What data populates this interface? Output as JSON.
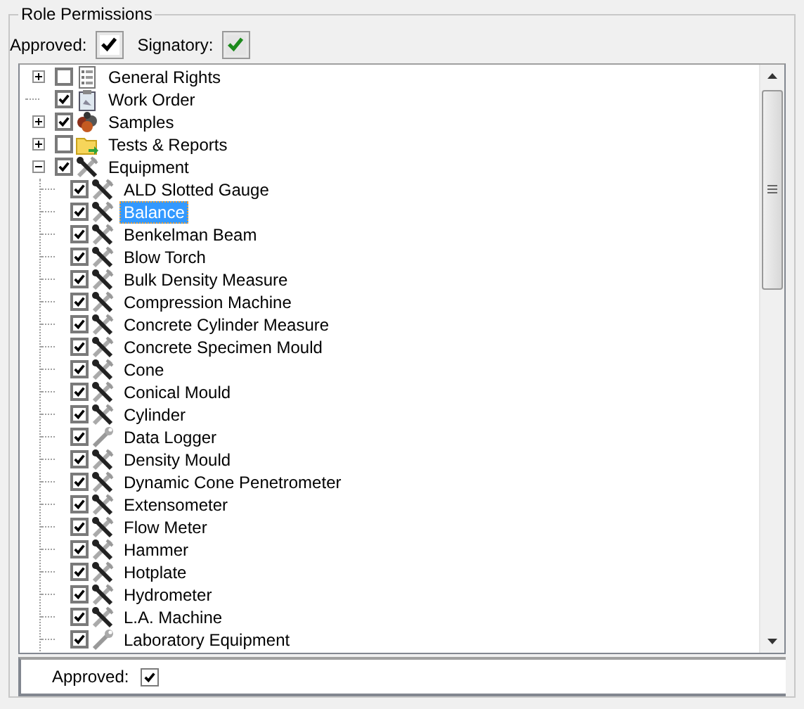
{
  "group": {
    "title": "Role Permissions"
  },
  "toggles": [
    {
      "label": "Approved:",
      "checked": true
    },
    {
      "label": "Signatory:",
      "checked": true
    }
  ],
  "tree": {
    "items": [
      {
        "label": "General Rights",
        "kind": "list",
        "checked": false,
        "expanded": false,
        "selected": false
      },
      {
        "label": "Work Order",
        "kind": "clipboard",
        "checked": true,
        "selected": false
      },
      {
        "label": "Samples",
        "kind": "samples",
        "checked": true,
        "expanded": false,
        "selected": false
      },
      {
        "label": "Tests & Reports",
        "kind": "folder",
        "checked": false,
        "expanded": false,
        "selected": false
      },
      {
        "label": "Equipment",
        "kind": "tools",
        "checked": true,
        "expanded": true,
        "selected": false,
        "children": [
          {
            "label": "ALD Slotted Gauge",
            "kind": "tools",
            "checked": true,
            "selected": false
          },
          {
            "label": "Balance",
            "kind": "tools",
            "checked": true,
            "selected": true
          },
          {
            "label": "Benkelman Beam",
            "kind": "tools",
            "checked": true,
            "selected": false
          },
          {
            "label": "Blow Torch",
            "kind": "tools",
            "checked": true,
            "selected": false
          },
          {
            "label": "Bulk Density Measure",
            "kind": "tools",
            "checked": true,
            "selected": false
          },
          {
            "label": "Compression Machine",
            "kind": "tools",
            "checked": true,
            "selected": false
          },
          {
            "label": "Concrete Cylinder Measure",
            "kind": "tools",
            "checked": true,
            "selected": false
          },
          {
            "label": "Concrete Specimen Mould",
            "kind": "tools",
            "checked": true,
            "selected": false
          },
          {
            "label": "Cone",
            "kind": "tools",
            "checked": true,
            "selected": false
          },
          {
            "label": "Conical Mould",
            "kind": "tools",
            "checked": true,
            "selected": false
          },
          {
            "label": "Cylinder",
            "kind": "tools",
            "checked": true,
            "selected": false
          },
          {
            "label": "Data Logger",
            "kind": "wrench",
            "checked": true,
            "selected": false
          },
          {
            "label": "Density Mould",
            "kind": "tools",
            "checked": true,
            "selected": false
          },
          {
            "label": "Dynamic Cone Penetrometer",
            "kind": "tools",
            "checked": true,
            "selected": false
          },
          {
            "label": "Extensometer",
            "kind": "tools",
            "checked": true,
            "selected": false
          },
          {
            "label": "Flow Meter",
            "kind": "tools",
            "checked": true,
            "selected": false
          },
          {
            "label": "Hammer",
            "kind": "tools",
            "checked": true,
            "selected": false
          },
          {
            "label": "Hotplate",
            "kind": "tools",
            "checked": true,
            "selected": false
          },
          {
            "label": "Hydrometer",
            "kind": "tools",
            "checked": true,
            "selected": false
          },
          {
            "label": "L.A. Machine",
            "kind": "tools",
            "checked": true,
            "selected": false
          },
          {
            "label": "Laboratory Equipment",
            "kind": "wrench",
            "checked": true,
            "selected": false
          }
        ]
      }
    ]
  },
  "footer": {
    "label": "Approved:",
    "checked": true
  }
}
